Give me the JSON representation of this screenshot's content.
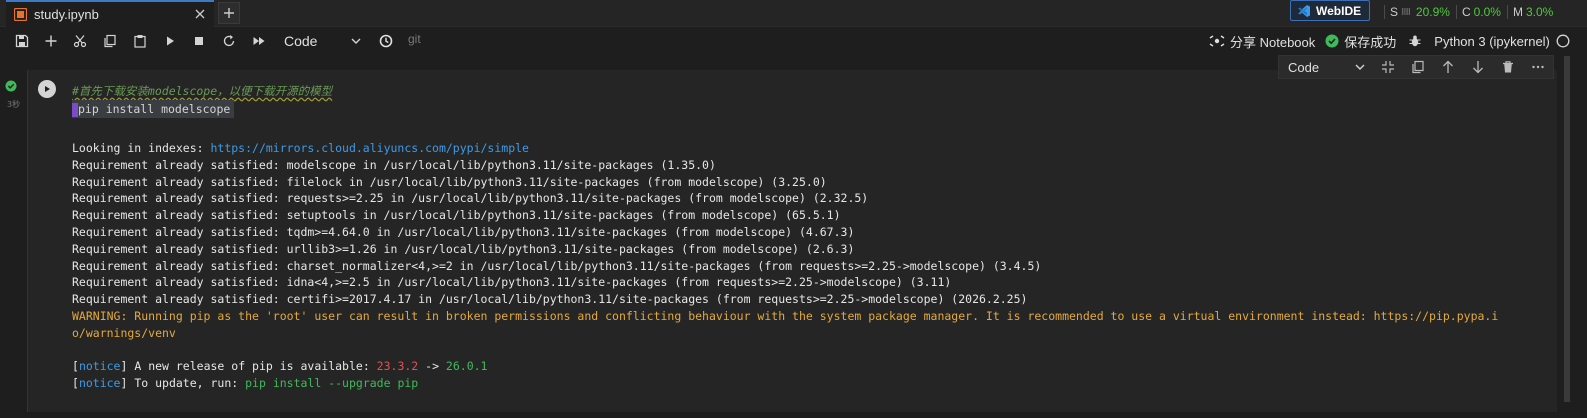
{
  "tabs": [
    {
      "label": "study.ipynb"
    }
  ],
  "header": {
    "webide_label": "WebIDE",
    "metrics": [
      {
        "key": "S",
        "bars": "IIIII",
        "value": "20.9%"
      },
      {
        "key": "C",
        "value": "0.0%"
      },
      {
        "key": "M",
        "value": "3.0%"
      }
    ]
  },
  "toolbar": {
    "cell_type": "Code",
    "git_label": "git",
    "share_label": "分享 Notebook",
    "save_status": "保存成功",
    "kernel_label": "Python 3 (ipykernel)"
  },
  "cell": {
    "exec_time": "3秒",
    "type_label": "Code",
    "comment": "#首先下载安装modelscope，以便下载开源的模型",
    "code": "pip install modelscope",
    "output": {
      "index_prefix": "Looking in indexes: ",
      "index_url": "https://mirrors.cloud.aliyuncs.com/pypi/simple",
      "requirements": [
        "Requirement already satisfied: modelscope in /usr/local/lib/python3.11/site-packages (1.35.0)",
        "Requirement already satisfied: filelock in /usr/local/lib/python3.11/site-packages (from modelscope) (3.25.0)",
        "Requirement already satisfied: requests>=2.25 in /usr/local/lib/python3.11/site-packages (from modelscope) (2.32.5)",
        "Requirement already satisfied: setuptools in /usr/local/lib/python3.11/site-packages (from modelscope) (65.5.1)",
        "Requirement already satisfied: tqdm>=4.64.0 in /usr/local/lib/python3.11/site-packages (from modelscope) (4.67.3)",
        "Requirement already satisfied: urllib3>=1.26 in /usr/local/lib/python3.11/site-packages (from modelscope) (2.6.3)",
        "Requirement already satisfied: charset_normalizer<4,>=2 in /usr/local/lib/python3.11/site-packages (from requests>=2.25->modelscope) (3.4.5)",
        "Requirement already satisfied: idna<4,>=2.5 in /usr/local/lib/python3.11/site-packages (from requests>=2.25->modelscope) (3.11)",
        "Requirement already satisfied: certifi>=2017.4.17 in /usr/local/lib/python3.11/site-packages (from requests>=2.25->modelscope) (2026.2.25)"
      ],
      "warning_line1": "WARNING: Running pip as the 'root' user can result in broken permissions and conflicting behaviour with the system package manager. It is recommended to use a virtual environment instead: https://pip.pypa.i",
      "warning_line2": "o/warnings/venv",
      "notice_tag": "notice",
      "notice1_text": " A new release of pip is available: ",
      "old_version": "23.3.2",
      "arrow": " -> ",
      "new_version": "26.0.1",
      "notice2_text": " To update, run: ",
      "update_cmd": "pip install --upgrade pip"
    }
  },
  "colors": {
    "accent": "#3c7ac7",
    "warning": "#e5a93a",
    "link": "#3c9be8",
    "success": "#4ec93a",
    "old_version": "#e05252",
    "new_version": "#3fba5a"
  }
}
